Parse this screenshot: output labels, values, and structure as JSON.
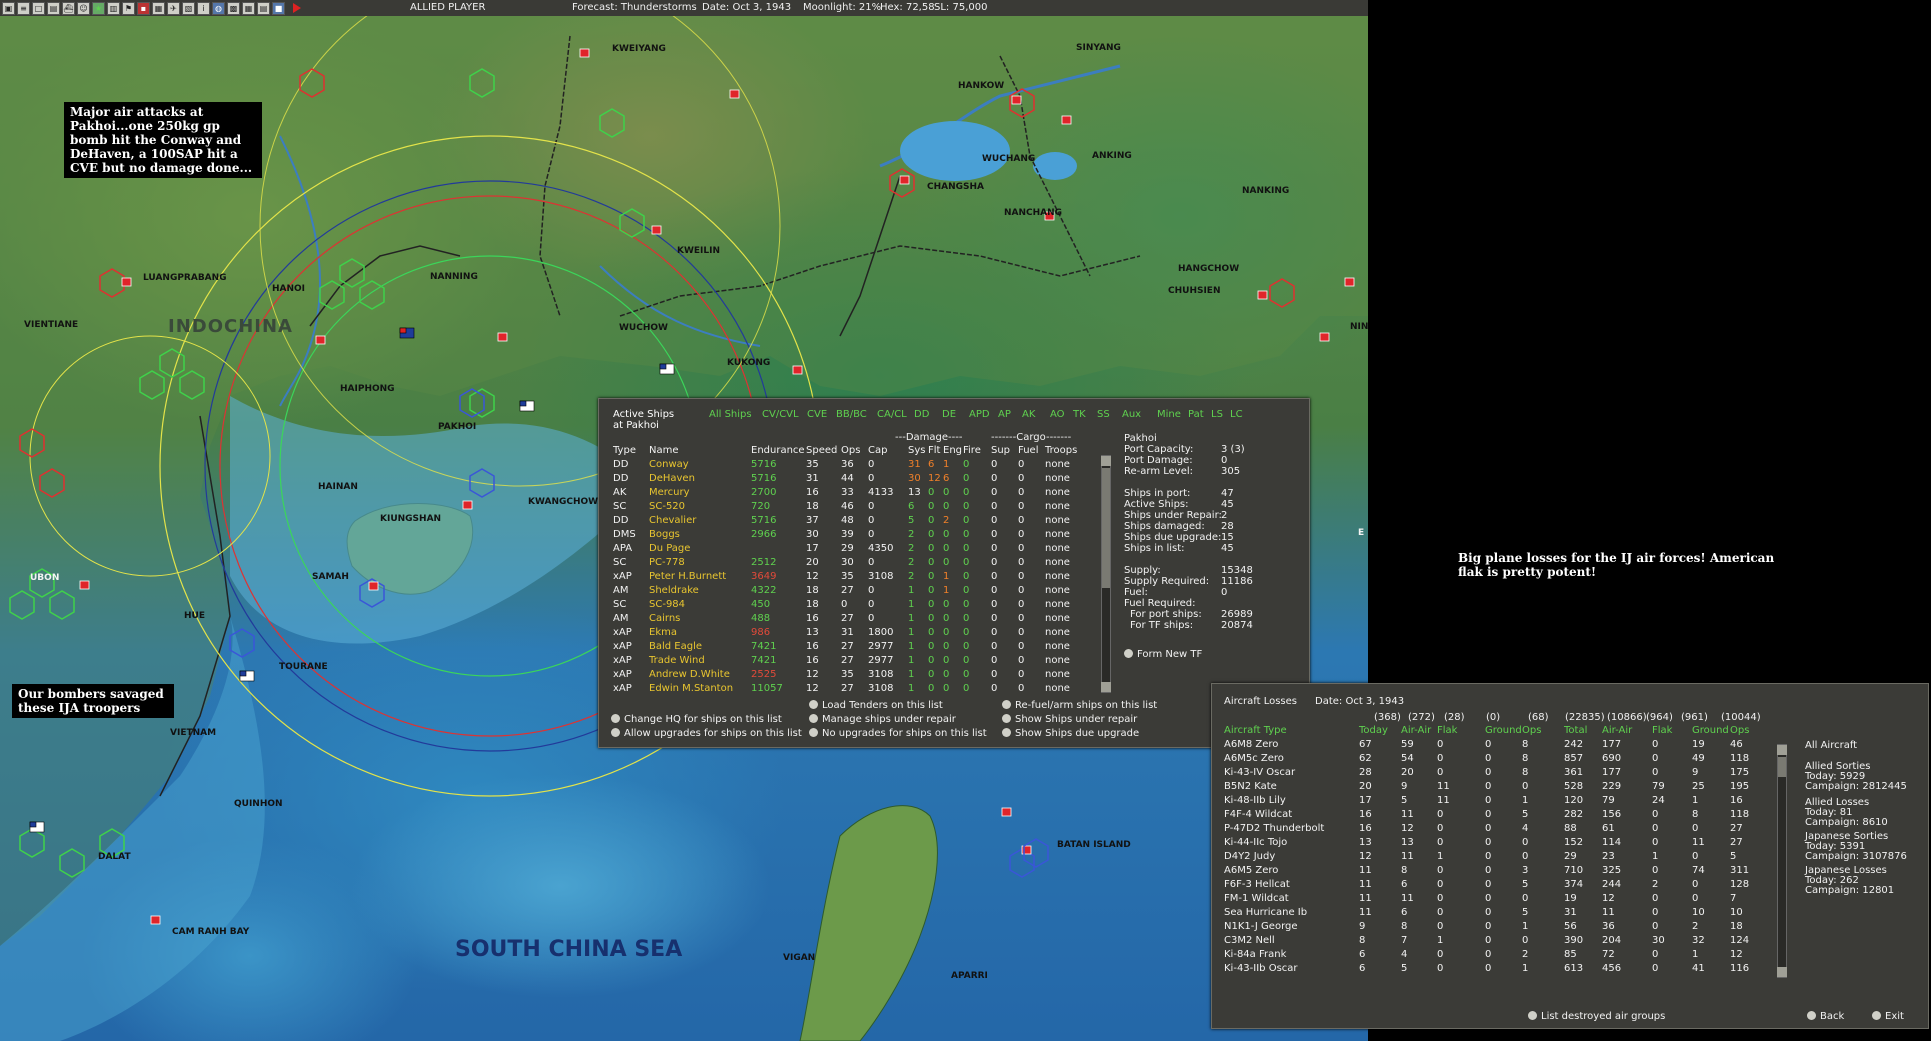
{
  "toolbar": {
    "player": "ALLIED PLAYER",
    "forecast": "Forecast: Thunderstorms",
    "date": "Date: Oct 3, 1943",
    "moonlight": "Moonlight: 21%",
    "hex": "Hex: 72,58",
    "sl": "SL: 75,000"
  },
  "map": {
    "labels": {
      "kweiyang": "KWEIYANG",
      "sinyang": "SINYANG",
      "hankow": "HANKOW",
      "wuchang": "WUCHANG",
      "anking": "ANKING",
      "nanking": "NANKING",
      "changsha": "CHANGSHA",
      "nanchang": "NANCHANG",
      "kweilin": "KWEILIN",
      "hangchow": "HANGCHOW",
      "chuhsien": "CHUHSIEN",
      "nanning": "NANNING",
      "hanoi": "HANOI",
      "luangprabang": "LUANGPRABANG",
      "vientiane": "VIENTIANE",
      "indochina": "INDOCHINA",
      "wuchow": "WUCHOW",
      "kukong": "KUKONG",
      "haiphong": "HAIPHONG",
      "pakhoi": "PAKHOI",
      "hainan": "HAINAN",
      "kiungshan": "KIUNGSHAN",
      "kwangchowan": "KWANGCHOWA",
      "samah": "SAMAH",
      "ubon": "UBON",
      "hue": "HUE",
      "tourane": "TOURANE",
      "vietnam": "VIETNAM",
      "quinhon": "QUINHON",
      "dalat": "DALAT",
      "camranhbay": "CAM RANH BAY",
      "south_china_sea": "SOUTH CHINA SEA",
      "vigan": "VIGAN",
      "aparri": "APARRI",
      "batan": "BATAN ISLAND",
      "nin": "NIN",
      "e": "E"
    },
    "notes": {
      "air_attacks": "Major air attacks at Pakhoi...one 250kg gp bomb hit the Conway and DeHaven, a 100SAP hit a CVE but no damage done...",
      "bombers": "Our bombers savaged these IJA troopers",
      "plane_losses": "Big plane losses for the IJ air forces!  American flak is pretty potent!"
    }
  },
  "ships_panel": {
    "title1": "Active Ships",
    "title2": "at Pakhoi",
    "categories": [
      "All Ships",
      "CV/CVL",
      "CVE",
      "BB/BC",
      "CA/CL",
      "DD",
      "DE",
      "APD",
      "AP",
      "AK",
      "AO",
      "TK",
      "SS",
      "Aux",
      "Mine",
      "Pat",
      "LS",
      "LC"
    ],
    "group_damage": "---Damage----",
    "group_cargo": "-------Cargo-------",
    "columns": [
      "Type",
      "Name",
      "Endurance",
      "Speed",
      "Ops",
      "Cap",
      "Sys",
      "Flt",
      "Eng",
      "Fire",
      "Sup",
      "Fuel",
      "Troops"
    ],
    "rows": [
      {
        "type": "DD",
        "name": "Conway",
        "end": "5716",
        "spd": "35",
        "ops": "36",
        "cap": "0",
        "sys": "31",
        "flt": "6",
        "eng": "1",
        "fire": "0",
        "sup": "0",
        "fuel": "0",
        "troops": "none",
        "endc": "green",
        "sysc": "orange"
      },
      {
        "type": "DD",
        "name": "DeHaven",
        "end": "5716",
        "spd": "31",
        "ops": "44",
        "cap": "0",
        "sys": "30",
        "flt": "12",
        "eng": "6",
        "fire": "0",
        "sup": "0",
        "fuel": "0",
        "troops": "none",
        "endc": "green",
        "sysc": "orange"
      },
      {
        "type": "AK",
        "name": "Mercury",
        "end": "2700",
        "spd": "16",
        "ops": "33",
        "cap": "4133",
        "sys": "13",
        "flt": "0",
        "eng": "0",
        "fire": "0",
        "sup": "0",
        "fuel": "0",
        "troops": "none",
        "endc": "green",
        "sysc": "white"
      },
      {
        "type": "SC",
        "name": "SC-520",
        "end": "720",
        "spd": "18",
        "ops": "46",
        "cap": "0",
        "sys": "6",
        "flt": "0",
        "eng": "0",
        "fire": "0",
        "sup": "0",
        "fuel": "0",
        "troops": "none",
        "endc": "green",
        "sysc": "green"
      },
      {
        "type": "DD",
        "name": "Chevalier",
        "end": "5716",
        "spd": "37",
        "ops": "48",
        "cap": "0",
        "sys": "5",
        "flt": "0",
        "eng": "2",
        "fire": "0",
        "sup": "0",
        "fuel": "0",
        "troops": "none",
        "endc": "green",
        "sysc": "green"
      },
      {
        "type": "DMS",
        "name": "Boggs",
        "end": "2966",
        "spd": "30",
        "ops": "39",
        "cap": "0",
        "sys": "2",
        "flt": "0",
        "eng": "0",
        "fire": "0",
        "sup": "0",
        "fuel": "0",
        "troops": "none",
        "endc": "green",
        "sysc": "green"
      },
      {
        "type": "APA",
        "name": "Du Page",
        "end": "",
        "spd": "17",
        "ops": "29",
        "cap": "4350",
        "sys": "2",
        "flt": "0",
        "eng": "0",
        "fire": "0",
        "sup": "0",
        "fuel": "0",
        "troops": "none",
        "endc": "red",
        "sysc": "green"
      },
      {
        "type": "SC",
        "name": "PC-778",
        "end": "2512",
        "spd": "20",
        "ops": "30",
        "cap": "0",
        "sys": "2",
        "flt": "0",
        "eng": "0",
        "fire": "0",
        "sup": "0",
        "fuel": "0",
        "troops": "none",
        "endc": "green",
        "sysc": "green"
      },
      {
        "type": "xAP",
        "name": "Peter H.Burnett",
        "end": "3649",
        "spd": "12",
        "ops": "35",
        "cap": "3108",
        "sys": "2",
        "flt": "0",
        "eng": "1",
        "fire": "0",
        "sup": "0",
        "fuel": "0",
        "troops": "none",
        "endc": "red",
        "sysc": "green"
      },
      {
        "type": "AM",
        "name": "Sheldrake",
        "end": "4322",
        "spd": "18",
        "ops": "27",
        "cap": "0",
        "sys": "1",
        "flt": "0",
        "eng": "1",
        "fire": "0",
        "sup": "0",
        "fuel": "0",
        "troops": "none",
        "endc": "green",
        "sysc": "green"
      },
      {
        "type": "SC",
        "name": "SC-984",
        "end": "450",
        "spd": "18",
        "ops": "0",
        "cap": "0",
        "sys": "1",
        "flt": "0",
        "eng": "0",
        "fire": "0",
        "sup": "0",
        "fuel": "0",
        "troops": "none",
        "endc": "green",
        "sysc": "green"
      },
      {
        "type": "AM",
        "name": "Cairns",
        "end": "488",
        "spd": "16",
        "ops": "27",
        "cap": "0",
        "sys": "1",
        "flt": "0",
        "eng": "0",
        "fire": "0",
        "sup": "0",
        "fuel": "0",
        "troops": "none",
        "endc": "green",
        "sysc": "green"
      },
      {
        "type": "xAP",
        "name": "Ekma",
        "end": "986",
        "spd": "13",
        "ops": "31",
        "cap": "1800",
        "sys": "1",
        "flt": "0",
        "eng": "0",
        "fire": "0",
        "sup": "0",
        "fuel": "0",
        "troops": "none",
        "endc": "red",
        "sysc": "green"
      },
      {
        "type": "xAP",
        "name": "Bald Eagle",
        "end": "7421",
        "spd": "16",
        "ops": "27",
        "cap": "2977",
        "sys": "1",
        "flt": "0",
        "eng": "0",
        "fire": "0",
        "sup": "0",
        "fuel": "0",
        "troops": "none",
        "endc": "green",
        "sysc": "green"
      },
      {
        "type": "xAP",
        "name": "Trade Wind",
        "end": "7421",
        "spd": "16",
        "ops": "27",
        "cap": "2977",
        "sys": "1",
        "flt": "0",
        "eng": "0",
        "fire": "0",
        "sup": "0",
        "fuel": "0",
        "troops": "none",
        "endc": "green",
        "sysc": "green"
      },
      {
        "type": "xAP",
        "name": "Andrew D.White",
        "end": "2525",
        "spd": "12",
        "ops": "35",
        "cap": "3108",
        "sys": "1",
        "flt": "0",
        "eng": "0",
        "fire": "0",
        "sup": "0",
        "fuel": "0",
        "troops": "none",
        "endc": "red",
        "sysc": "green"
      },
      {
        "type": "xAP",
        "name": "Edwin M.Stanton",
        "end": "11057",
        "spd": "12",
        "ops": "27",
        "cap": "3108",
        "sys": "1",
        "flt": "0",
        "eng": "0",
        "fire": "0",
        "sup": "0",
        "fuel": "0",
        "troops": "none",
        "endc": "green",
        "sysc": "green"
      }
    ],
    "port_info": {
      "port": "Pakhoi",
      "capacity_label": "Port Capacity:",
      "capacity": "3 (3)",
      "damage_label": "Port Damage:",
      "damage": "0",
      "rearm_label": "Re-arm Level:",
      "rearm": "305",
      "inport_label": "Ships in port:",
      "inport": "47",
      "active_label": "Active Ships:",
      "active": "45",
      "repair_label": "Ships under Repair:",
      "repair": "2",
      "damaged_label": "Ships damaged:",
      "damaged": "28",
      "upgrade_label": "Ships due upgrade:",
      "upgrade": "15",
      "inlist_label": "Ships in list:",
      "inlist": "45",
      "supply_label": "Supply:",
      "supply": "15348",
      "supreq_label": "Supply Required:",
      "supreq": "11186",
      "fuel_label": "Fuel:",
      "fuel": "0",
      "fuelreq_label": "Fuel Required:",
      "forport_label": "For port ships:",
      "forport": "26989",
      "fortf_label": "For TF ships:",
      "fortf": "20874",
      "form_tf": "Form New TF"
    },
    "actions": [
      "Change HQ for ships on this list",
      "Load Tenders on this list",
      "Re-fuel/arm ships on this list",
      "Allow upgrades for ships on this list",
      "Manage ships under repair",
      "Show Ships under repair",
      "No upgrades for ships on this list",
      "Show Ships due upgrade"
    ]
  },
  "losses_panel": {
    "title": "Aircraft Losses",
    "date": "Date: Oct 3, 1943",
    "totals": [
      "(368)",
      "(272)",
      "(28)",
      "(0)",
      "(68)",
      "(22835)",
      "(10866)",
      "(964)",
      "(961)",
      "(10044)"
    ],
    "columns": [
      "Aircraft Type",
      "Today",
      "Air-Air",
      "Flak",
      "Ground",
      "Ops",
      "Total",
      "Air-Air",
      "Flak",
      "Ground",
      "Ops"
    ],
    "rows": [
      [
        "A6M8 Zero",
        "67",
        "59",
        "0",
        "0",
        "8",
        "242",
        "177",
        "0",
        "19",
        "46"
      ],
      [
        "A6M5c Zero",
        "62",
        "54",
        "0",
        "0",
        "8",
        "857",
        "690",
        "0",
        "49",
        "118"
      ],
      [
        "Ki-43-IV Oscar",
        "28",
        "20",
        "0",
        "0",
        "8",
        "361",
        "177",
        "0",
        "9",
        "175"
      ],
      [
        "B5N2 Kate",
        "20",
        "9",
        "11",
        "0",
        "0",
        "528",
        "229",
        "79",
        "25",
        "195"
      ],
      [
        "Ki-48-IIb Lily",
        "17",
        "5",
        "11",
        "0",
        "1",
        "120",
        "79",
        "24",
        "1",
        "16"
      ],
      [
        "F4F-4 Wildcat",
        "16",
        "11",
        "0",
        "0",
        "5",
        "282",
        "156",
        "0",
        "8",
        "118"
      ],
      [
        "P-47D2 Thunderbolt",
        "16",
        "12",
        "0",
        "0",
        "4",
        "88",
        "61",
        "0",
        "0",
        "27"
      ],
      [
        "Ki-44-IIc Tojo",
        "13",
        "13",
        "0",
        "0",
        "0",
        "152",
        "114",
        "0",
        "11",
        "27"
      ],
      [
        "D4Y2 Judy",
        "12",
        "11",
        "1",
        "0",
        "0",
        "29",
        "23",
        "1",
        "0",
        "5"
      ],
      [
        "A6M5 Zero",
        "11",
        "8",
        "0",
        "0",
        "3",
        "710",
        "325",
        "0",
        "74",
        "311"
      ],
      [
        "F6F-3 Hellcat",
        "11",
        "6",
        "0",
        "0",
        "5",
        "374",
        "244",
        "2",
        "0",
        "128"
      ],
      [
        "FM-1 Wildcat",
        "11",
        "11",
        "0",
        "0",
        "0",
        "19",
        "12",
        "0",
        "0",
        "7"
      ],
      [
        "Sea Hurricane Ib",
        "11",
        "6",
        "0",
        "0",
        "5",
        "31",
        "11",
        "0",
        "10",
        "10"
      ],
      [
        "N1K1-J George",
        "9",
        "8",
        "0",
        "0",
        "1",
        "56",
        "36",
        "0",
        "2",
        "18"
      ],
      [
        "C3M2 Nell",
        "8",
        "7",
        "1",
        "0",
        "0",
        "390",
        "204",
        "30",
        "32",
        "124"
      ],
      [
        "Ki-84a Frank",
        "6",
        "4",
        "0",
        "0",
        "2",
        "85",
        "72",
        "0",
        "1",
        "12"
      ],
      [
        "Ki-43-IIb Oscar",
        "6",
        "5",
        "0",
        "0",
        "1",
        "613",
        "456",
        "0",
        "41",
        "116"
      ]
    ],
    "side": {
      "all_aircraft": "All Aircraft",
      "allied_sorties": "Allied Sorties",
      "allied_sorties_today": "Today:  5929",
      "allied_sorties_campaign": "Campaign: 2812445",
      "allied_losses": "Allied Losses",
      "allied_losses_today": "Today:  81",
      "allied_losses_campaign": "Campaign: 8610",
      "jap_sorties": "Japanese Sorties",
      "jap_sorties_today": "Today:  5391",
      "jap_sorties_campaign": "Campaign: 3107876",
      "jap_losses": "Japanese Losses",
      "jap_losses_today": "Today:  262",
      "jap_losses_campaign": "Campaign: 12801"
    },
    "list_destroyed": "List destroyed air groups",
    "back": "Back",
    "exit": "Exit"
  }
}
